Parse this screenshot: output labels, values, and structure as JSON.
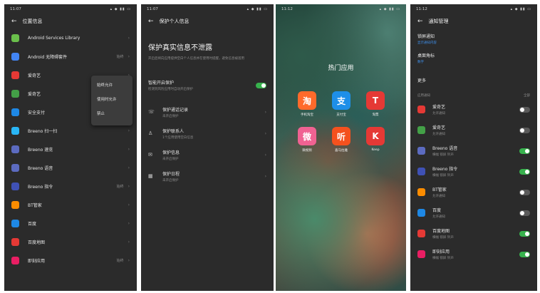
{
  "colors": {
    "panel_bg": "#2b2b2b",
    "switch_on": "#37b24d",
    "switch_off": "#5b5b5b",
    "link_blue": "#3e8ee8"
  },
  "panel1": {
    "time": "11:07",
    "title": "位置信息",
    "apps": [
      {
        "name": "Android Services Library",
        "perm": "",
        "icon_color": "#6abf4b",
        "icon": "android-icon"
      },
      {
        "name": "Android 无障碍套件",
        "perm": "始终",
        "icon_color": "#4285f4",
        "icon": "accessibility-icon"
      },
      {
        "name": "爱奇艺",
        "perm": "",
        "icon_color": "#e53935",
        "icon": "tv-icon"
      },
      {
        "name": "爱奇艺",
        "perm": "",
        "icon_color": "#43a047",
        "icon": "iqiyi-icon"
      },
      {
        "name": "安全支付",
        "perm": "",
        "icon_color": "#1e88e5",
        "icon": "pay-icon"
      },
      {
        "name": "Breeno 扫一扫",
        "perm": "",
        "icon_color": "#29b6f6",
        "icon": "scan-icon"
      },
      {
        "name": "Breeno 速览",
        "perm": "",
        "icon_color": "#5c6bc0",
        "icon": "breeno-icon"
      },
      {
        "name": "Breeno 语音",
        "perm": "",
        "icon_color": "#5c6bc0",
        "icon": "voice-icon"
      },
      {
        "name": "Breeno 指令",
        "perm": "始终",
        "icon_color": "#3f51b5",
        "icon": "command-icon"
      },
      {
        "name": "BT管家",
        "perm": "",
        "icon_color": "#fb8c00",
        "icon": "bt-icon"
      },
      {
        "name": "百度",
        "perm": "",
        "icon_color": "#1e88e5",
        "icon": "baidu-icon"
      },
      {
        "name": "百度地图",
        "perm": "",
        "icon_color": "#e53935",
        "icon": "map-pin-icon"
      },
      {
        "name": "即刻应用",
        "perm": "始终",
        "icon_color": "#e91e63",
        "icon": "app-icon"
      }
    ],
    "popup": [
      "始终允许",
      "使用时允许",
      "禁止"
    ]
  },
  "panel2": {
    "time": "11:07",
    "title": "保护个人信息",
    "heading": "保护真实信息不泄露",
    "description": "开启后将向应用提供空白个人信息并在使用时提醒，避免信息被滥用",
    "toggle": {
      "title": "智能开启保护",
      "subtitle": "检测到风险应用时自动开启保护"
    },
    "items": [
      {
        "icon": "phone-icon",
        "title": "保护通话记录",
        "subtitle": "未开启保护"
      },
      {
        "icon": "person-icon",
        "title": "保护联系人",
        "subtitle": "1个应用使用空白信息"
      },
      {
        "icon": "message-icon",
        "title": "保护信息",
        "subtitle": "未开启保护"
      },
      {
        "icon": "calendar-icon",
        "title": "保护日程",
        "subtitle": "未开启保护"
      }
    ]
  },
  "panel3": {
    "time": "11:12",
    "folder_title": "热门应用",
    "apps": [
      {
        "label": "手机淘宝",
        "glyph": "淘",
        "color": "#ff6a2b"
      },
      {
        "label": "支付宝",
        "glyph": "支",
        "color": "#1e8fe8"
      },
      {
        "label": "淘票",
        "glyph": "T",
        "color": "#e53935"
      },
      {
        "label": "微视频",
        "glyph": "微",
        "color": "#f06292"
      },
      {
        "label": "喜马拉雅",
        "glyph": "听",
        "color": "#f4511e"
      },
      {
        "label": "Keep",
        "glyph": "K",
        "color": "#e53935"
      }
    ]
  },
  "panel4": {
    "time": "11:12",
    "title": "通知管理",
    "lock_screen": {
      "title": "锁屏通知",
      "value": "显示通知内容"
    },
    "badge": {
      "title": "桌面角标",
      "value": "数字"
    },
    "more": "更多",
    "section_left": "应用通知",
    "section_right": "全部",
    "apps": [
      {
        "name": "爱奇艺",
        "sub": "允许通知",
        "on": false,
        "color": "#e53935",
        "icon": "tv-icon"
      },
      {
        "name": "爱奇艺",
        "sub": "允许通知",
        "on": false,
        "color": "#43a047",
        "icon": "iqiyi-icon"
      },
      {
        "name": "Breeno 语音",
        "sub": "横幅 锁屏 铃声",
        "on": true,
        "color": "#5c6bc0",
        "icon": "voice-icon"
      },
      {
        "name": "Breeno 指令",
        "sub": "横幅 锁屏 铃声",
        "on": true,
        "color": "#3f51b5",
        "icon": "command-icon"
      },
      {
        "name": "BT管家",
        "sub": "允许通知",
        "on": false,
        "color": "#fb8c00",
        "icon": "bt-icon"
      },
      {
        "name": "百度",
        "sub": "允许通知",
        "on": false,
        "color": "#1e88e5",
        "icon": "baidu-icon"
      },
      {
        "name": "百度地图",
        "sub": "横幅 锁屏 铃声",
        "on": true,
        "color": "#e53935",
        "icon": "map-pin-icon"
      },
      {
        "name": "即刻应用",
        "sub": "横幅 锁屏 铃声",
        "on": true,
        "color": "#e91e63",
        "icon": "app-icon"
      }
    ]
  }
}
